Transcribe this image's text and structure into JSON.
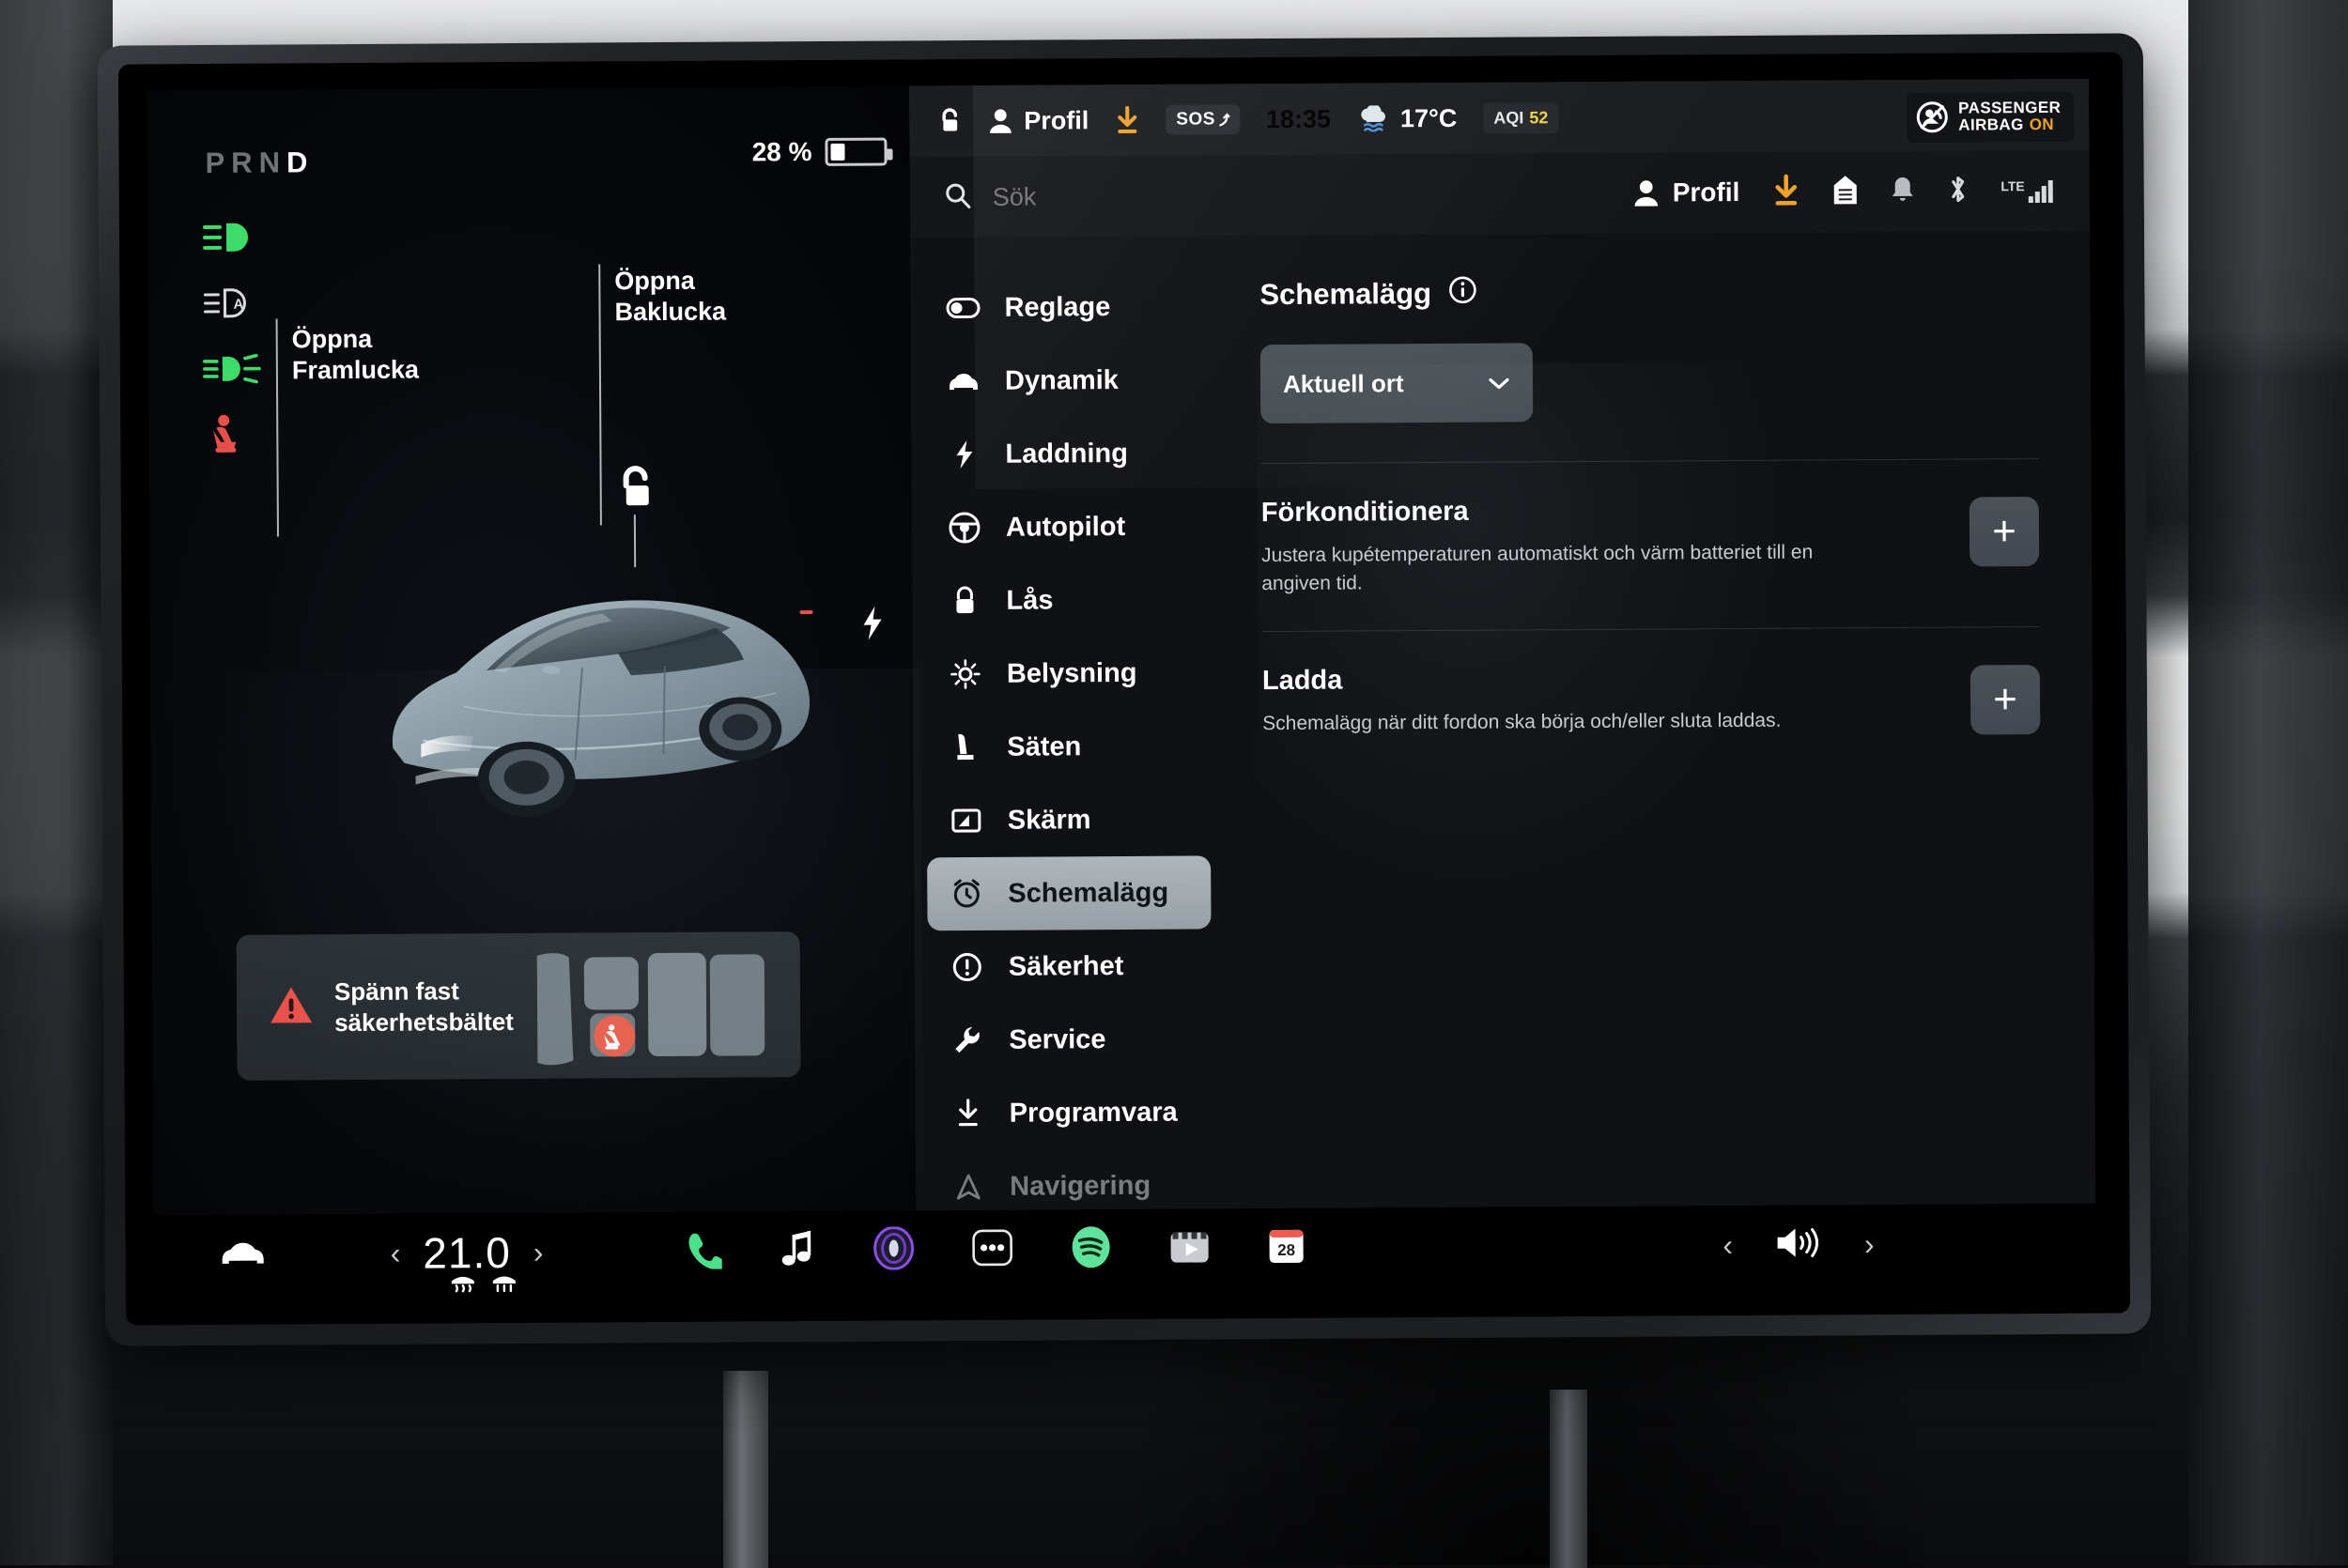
{
  "instrument": {
    "gear_indicator": "PRND",
    "gear_selected": "D",
    "battery_percent": "28 %",
    "battery_level": 28,
    "telltales": [
      {
        "name": "high-beam-icon",
        "state": "on",
        "color": "#3ddc6a"
      },
      {
        "name": "auto-high-beam-icon",
        "state": "off",
        "color": "#d7dade"
      },
      {
        "name": "fog-light-icon",
        "state": "on",
        "color": "#3ddc6a"
      },
      {
        "name": "seatbelt-warning-icon",
        "state": "on",
        "color": "#e8514b"
      }
    ]
  },
  "car_panel": {
    "callout_front": "Öppna\nFramlucka",
    "callout_front_line1": "Öppna",
    "callout_front_line2": "Framlucka",
    "callout_rear_line1": "Öppna",
    "callout_rear_line2": "Baklucka",
    "lock_state": "unlocked",
    "charge_port_icon": "charge-bolt-icon",
    "warning": {
      "line1": "Spänn fast",
      "line2": "säkerhetsbältet",
      "icon": "warning-triangle-icon",
      "color": "#e8514b"
    }
  },
  "status_bar": {
    "battery_percent": "28 %",
    "lock_icon": "unlock-icon",
    "profile_label": "Profil",
    "download_icon": "software-download-icon",
    "download_color": "#f0a22a",
    "sos_label": "SOS",
    "time": "18:35",
    "weather_icon": "cloud-icon",
    "temperature": "17°C",
    "aqi_label": "AQI",
    "aqi_value": "52",
    "aqi_color": "#f2d24b",
    "airbag_line1": "PASSENGER",
    "airbag_line2": "AIRBAG",
    "airbag_state": "ON",
    "airbag_state_color": "#f0a22a"
  },
  "nav_bar": {
    "search_placeholder": "Sök",
    "search_value": "",
    "search_icon": "search-icon",
    "profile_label": "Profil",
    "icons": [
      {
        "name": "software-download-icon",
        "color": "#f0a22a"
      },
      {
        "name": "garage-door-icon",
        "color": "#ffffff"
      },
      {
        "name": "bell-icon",
        "color": "#b9bdc2"
      },
      {
        "name": "bluetooth-icon",
        "color": "#d7dade"
      },
      {
        "name": "lte-signal-icon",
        "label": "LTE",
        "color": "#d7dade"
      }
    ]
  },
  "menu": {
    "items": [
      {
        "label": "Reglage",
        "icon": "toggle-icon",
        "active": false
      },
      {
        "label": "Dynamik",
        "icon": "car-front-icon",
        "active": false
      },
      {
        "label": "Laddning",
        "icon": "bolt-icon",
        "active": false
      },
      {
        "label": "Autopilot",
        "icon": "steering-wheel-icon",
        "active": false
      },
      {
        "label": "Lås",
        "icon": "lock-icon",
        "active": false
      },
      {
        "label": "Belysning",
        "icon": "sun-icon",
        "active": false
      },
      {
        "label": "Säten",
        "icon": "seat-icon",
        "active": false
      },
      {
        "label": "Skärm",
        "icon": "display-icon",
        "active": false
      },
      {
        "label": "Schemalägg",
        "icon": "alarm-clock-icon",
        "active": true
      },
      {
        "label": "Säkerhet",
        "icon": "exclamation-circle-icon",
        "active": false
      },
      {
        "label": "Service",
        "icon": "wrench-icon",
        "active": false
      },
      {
        "label": "Programvara",
        "icon": "download-icon",
        "active": false
      },
      {
        "label": "Navigering",
        "icon": "navigation-icon",
        "active": false
      }
    ]
  },
  "content": {
    "title": "Schemalägg",
    "info_icon": "info-icon",
    "location_select": {
      "value": "Aktuell ort",
      "chevron": "chevron-down-icon"
    },
    "rows": [
      {
        "title": "Förkonditionera",
        "description": "Justera kupétemperaturen automatiskt och värm batteriet till en angiven tid.",
        "action_label": "+",
        "action_name": "add-precondition-button"
      },
      {
        "title": "Ladda",
        "description": "Schemalägg när ditt fordon ska börja och/eller sluta laddas.",
        "action_label": "+",
        "action_name": "add-charge-schedule-button"
      }
    ]
  },
  "dock": {
    "car_icon": "car-icon",
    "temperature": "21.0",
    "temp_prev": "‹",
    "temp_next": "›",
    "defrost_front_icon": "defrost-front-icon",
    "defrost_rear_icon": "defrost-rear-icon",
    "apps": [
      {
        "name": "phone-icon",
        "color": "#4ce08a"
      },
      {
        "name": "music-note-icon",
        "color": "#ffffff"
      },
      {
        "name": "voice-assistant-icon",
        "color": "#8b4ee8"
      },
      {
        "name": "more-apps-icon",
        "color": "#ffffff"
      },
      {
        "name": "spotify-icon",
        "color": "#5fe39a"
      },
      {
        "name": "theater-icon",
        "color": "#c9ccd0"
      },
      {
        "name": "calendar-icon",
        "color": "#ffffff",
        "label": "28"
      }
    ],
    "volume_icon": "volume-icon",
    "vol_prev": "‹",
    "vol_next": "›"
  },
  "colors": {
    "accent_amber": "#f0a22a",
    "green": "#3ddc6a",
    "red": "#e8514b",
    "selected_pill": "#a6aeb4"
  }
}
